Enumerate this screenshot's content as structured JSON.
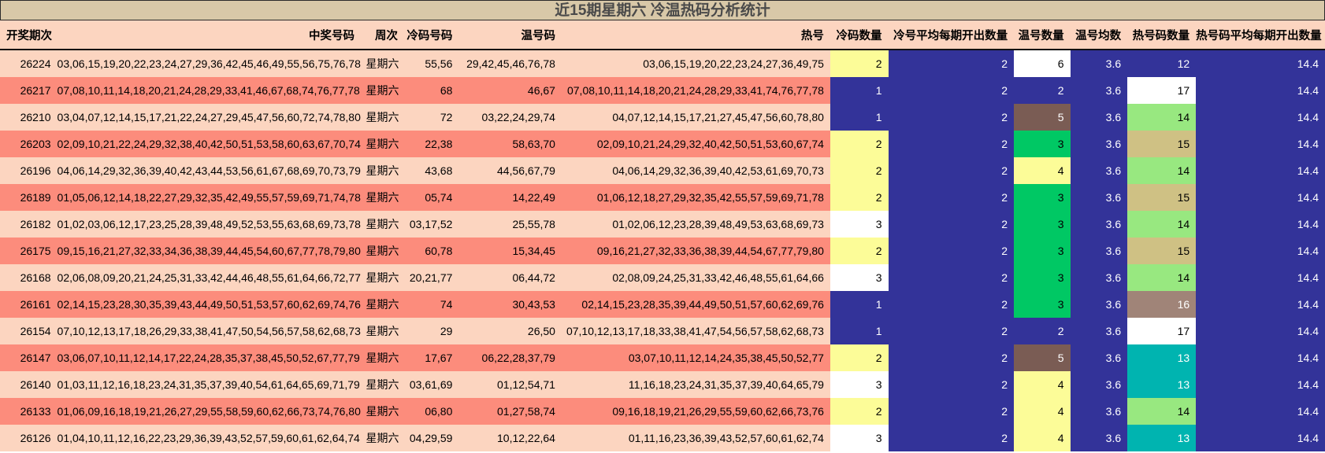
{
  "title": "近15期星期六 冷温热码分析统计",
  "headers": [
    "开奖期次",
    "中奖号码",
    "周次",
    "冷码号码",
    "温号码",
    "热号",
    "冷码数量",
    "冷号平均每期开出数量",
    "温号数量",
    "温号均数",
    "热号码数量",
    "热号码平均每期开出数量"
  ],
  "colors": {
    "header_bg": "#fcd5c0",
    "title_bg": "#d8c8a8",
    "row_light": "#fcd5c0",
    "row_dark": "#fc8c7c",
    "navy": "#333399",
    "yellow": "#fcfc98",
    "white": "#ffffff",
    "green": "#00c864",
    "brown": "#7a5c54",
    "tan": "#cfc184",
    "light_green": "#98e880",
    "grey_brown": "#a08478",
    "teal": "#00b4b0"
  },
  "rows": [
    {
      "period": "26224",
      "numbers": "03,06,15,19,20,22,23,24,27,29,36,42,45,46,49,55,56,75,76,78",
      "week": "星期六",
      "cold": "55,56",
      "warm": "29,42,45,46,76,78",
      "hot": "03,06,15,19,20,22,23,24,27,36,49,75",
      "cold_count": "2",
      "cold_avg": "2",
      "warm_count": "6",
      "warm_avg": "3.6",
      "hot_count": "12",
      "hot_avg": "14.4",
      "cold_count_color": "yellow",
      "warm_count_color": "white",
      "hot_count_color": "navy"
    },
    {
      "period": "26217",
      "numbers": "07,08,10,11,14,18,20,21,24,28,29,33,41,46,67,68,74,76,77,78",
      "week": "星期六",
      "cold": "68",
      "warm": "46,67",
      "hot": "07,08,10,11,14,18,20,21,24,28,29,33,41,74,76,77,78",
      "cold_count": "1",
      "cold_avg": "2",
      "warm_count": "2",
      "warm_avg": "3.6",
      "hot_count": "17",
      "hot_avg": "14.4",
      "cold_count_color": "navy",
      "warm_count_color": "navy",
      "hot_count_color": "white"
    },
    {
      "period": "26210",
      "numbers": "03,04,07,12,14,15,17,21,22,24,27,29,45,47,56,60,72,74,78,80",
      "week": "星期六",
      "cold": "72",
      "warm": "03,22,24,29,74",
      "hot": "04,07,12,14,15,17,21,27,45,47,56,60,78,80",
      "cold_count": "1",
      "cold_avg": "2",
      "warm_count": "5",
      "warm_avg": "3.6",
      "hot_count": "14",
      "hot_avg": "14.4",
      "cold_count_color": "navy",
      "warm_count_color": "brown",
      "hot_count_color": "light_green"
    },
    {
      "period": "26203",
      "numbers": "02,09,10,21,22,24,29,32,38,40,42,50,51,53,58,60,63,67,70,74",
      "week": "星期六",
      "cold": "22,38",
      "warm": "58,63,70",
      "hot": "02,09,10,21,24,29,32,40,42,50,51,53,60,67,74",
      "cold_count": "2",
      "cold_avg": "2",
      "warm_count": "3",
      "warm_avg": "3.6",
      "hot_count": "15",
      "hot_avg": "14.4",
      "cold_count_color": "yellow",
      "warm_count_color": "green",
      "hot_count_color": "tan"
    },
    {
      "period": "26196",
      "numbers": "04,06,14,29,32,36,39,40,42,43,44,53,56,61,67,68,69,70,73,79",
      "week": "星期六",
      "cold": "43,68",
      "warm": "44,56,67,79",
      "hot": "04,06,14,29,32,36,39,40,42,53,61,69,70,73",
      "cold_count": "2",
      "cold_avg": "2",
      "warm_count": "4",
      "warm_avg": "3.6",
      "hot_count": "14",
      "hot_avg": "14.4",
      "cold_count_color": "yellow",
      "warm_count_color": "yellow",
      "hot_count_color": "light_green"
    },
    {
      "period": "26189",
      "numbers": "01,05,06,12,14,18,22,27,29,32,35,42,49,55,57,59,69,71,74,78",
      "week": "星期六",
      "cold": "05,74",
      "warm": "14,22,49",
      "hot": "01,06,12,18,27,29,32,35,42,55,57,59,69,71,78",
      "cold_count": "2",
      "cold_avg": "2",
      "warm_count": "3",
      "warm_avg": "3.6",
      "hot_count": "15",
      "hot_avg": "14.4",
      "cold_count_color": "yellow",
      "warm_count_color": "green",
      "hot_count_color": "tan"
    },
    {
      "period": "26182",
      "numbers": "01,02,03,06,12,17,23,25,28,39,48,49,52,53,55,63,68,69,73,78",
      "week": "星期六",
      "cold": "03,17,52",
      "warm": "25,55,78",
      "hot": "01,02,06,12,23,28,39,48,49,53,63,68,69,73",
      "cold_count": "3",
      "cold_avg": "2",
      "warm_count": "3",
      "warm_avg": "3.6",
      "hot_count": "14",
      "hot_avg": "14.4",
      "cold_count_color": "white",
      "warm_count_color": "green",
      "hot_count_color": "light_green"
    },
    {
      "period": "26175",
      "numbers": "09,15,16,21,27,32,33,34,36,38,39,44,45,54,60,67,77,78,79,80",
      "week": "星期六",
      "cold": "60,78",
      "warm": "15,34,45",
      "hot": "09,16,21,27,32,33,36,38,39,44,54,67,77,79,80",
      "cold_count": "2",
      "cold_avg": "2",
      "warm_count": "3",
      "warm_avg": "3.6",
      "hot_count": "15",
      "hot_avg": "14.4",
      "cold_count_color": "yellow",
      "warm_count_color": "green",
      "hot_count_color": "tan"
    },
    {
      "period": "26168",
      "numbers": "02,06,08,09,20,21,24,25,31,33,42,44,46,48,55,61,64,66,72,77",
      "week": "星期六",
      "cold": "20,21,77",
      "warm": "06,44,72",
      "hot": "02,08,09,24,25,31,33,42,46,48,55,61,64,66",
      "cold_count": "3",
      "cold_avg": "2",
      "warm_count": "3",
      "warm_avg": "3.6",
      "hot_count": "14",
      "hot_avg": "14.4",
      "cold_count_color": "white",
      "warm_count_color": "green",
      "hot_count_color": "light_green"
    },
    {
      "period": "26161",
      "numbers": "02,14,15,23,28,30,35,39,43,44,49,50,51,53,57,60,62,69,74,76",
      "week": "星期六",
      "cold": "74",
      "warm": "30,43,53",
      "hot": "02,14,15,23,28,35,39,44,49,50,51,57,60,62,69,76",
      "cold_count": "1",
      "cold_avg": "2",
      "warm_count": "3",
      "warm_avg": "3.6",
      "hot_count": "16",
      "hot_avg": "14.4",
      "cold_count_color": "navy",
      "warm_count_color": "green",
      "hot_count_color": "grey_brown"
    },
    {
      "period": "26154",
      "numbers": "07,10,12,13,17,18,26,29,33,38,41,47,50,54,56,57,58,62,68,73",
      "week": "星期六",
      "cold": "29",
      "warm": "26,50",
      "hot": "07,10,12,13,17,18,33,38,41,47,54,56,57,58,62,68,73",
      "cold_count": "1",
      "cold_avg": "2",
      "warm_count": "2",
      "warm_avg": "3.6",
      "hot_count": "17",
      "hot_avg": "14.4",
      "cold_count_color": "navy",
      "warm_count_color": "navy",
      "hot_count_color": "white"
    },
    {
      "period": "26147",
      "numbers": "03,06,07,10,11,12,14,17,22,24,28,35,37,38,45,50,52,67,77,79",
      "week": "星期六",
      "cold": "17,67",
      "warm": "06,22,28,37,79",
      "hot": "03,07,10,11,12,14,24,35,38,45,50,52,77",
      "cold_count": "2",
      "cold_avg": "2",
      "warm_count": "5",
      "warm_avg": "3.6",
      "hot_count": "13",
      "hot_avg": "14.4",
      "cold_count_color": "yellow",
      "warm_count_color": "brown",
      "hot_count_color": "teal"
    },
    {
      "period": "26140",
      "numbers": "01,03,11,12,16,18,23,24,31,35,37,39,40,54,61,64,65,69,71,79",
      "week": "星期六",
      "cold": "03,61,69",
      "warm": "01,12,54,71",
      "hot": "11,16,18,23,24,31,35,37,39,40,64,65,79",
      "cold_count": "3",
      "cold_avg": "2",
      "warm_count": "4",
      "warm_avg": "3.6",
      "hot_count": "13",
      "hot_avg": "14.4",
      "cold_count_color": "white",
      "warm_count_color": "yellow",
      "hot_count_color": "teal"
    },
    {
      "period": "26133",
      "numbers": "01,06,09,16,18,19,21,26,27,29,55,58,59,60,62,66,73,74,76,80",
      "week": "星期六",
      "cold": "06,80",
      "warm": "01,27,58,74",
      "hot": "09,16,18,19,21,26,29,55,59,60,62,66,73,76",
      "cold_count": "2",
      "cold_avg": "2",
      "warm_count": "4",
      "warm_avg": "3.6",
      "hot_count": "14",
      "hot_avg": "14.4",
      "cold_count_color": "yellow",
      "warm_count_color": "yellow",
      "hot_count_color": "light_green"
    },
    {
      "period": "26126",
      "numbers": "01,04,10,11,12,16,22,23,29,36,39,43,52,57,59,60,61,62,64,74",
      "week": "星期六",
      "cold": "04,29,59",
      "warm": "10,12,22,64",
      "hot": "01,11,16,23,36,39,43,52,57,60,61,62,74",
      "cold_count": "3",
      "cold_avg": "2",
      "warm_count": "4",
      "warm_avg": "3.6",
      "hot_count": "13",
      "hot_avg": "14.4",
      "cold_count_color": "white",
      "warm_count_color": "yellow",
      "hot_count_color": "teal"
    }
  ]
}
